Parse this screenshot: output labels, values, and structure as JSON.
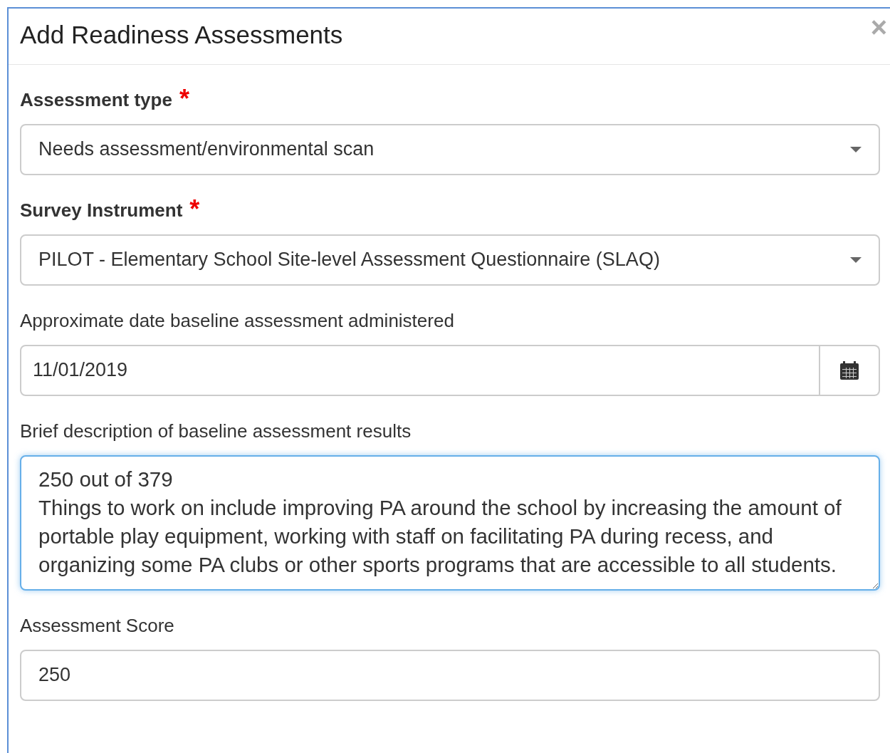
{
  "modal": {
    "title": "Add Readiness Assessments",
    "close": "×"
  },
  "fields": [
    {
      "kind": "select",
      "label": "Assessment type",
      "required": true,
      "value": "Needs assessment/environmental scan"
    },
    {
      "kind": "select",
      "label": "Survey Instrument",
      "required": true,
      "value": "PILOT - Elementary School Site-level Assessment Questionnaire (SLAQ)"
    },
    {
      "kind": "date",
      "label": "Approximate date baseline assessment administered",
      "required": false,
      "value": "11/01/2019"
    },
    {
      "kind": "textarea",
      "label": "Brief description of baseline assessment results",
      "required": false,
      "focused": true,
      "value": "250 out of 379\nThings to work on include improving PA around the school by increasing the amount of portable play equipment, working with staff on facilitating PA during recess, and organizing some PA clubs or other sports programs that are accessible to all students."
    },
    {
      "kind": "text",
      "label": "Assessment Score",
      "required": false,
      "value": "250"
    }
  ],
  "required_mark": "*"
}
